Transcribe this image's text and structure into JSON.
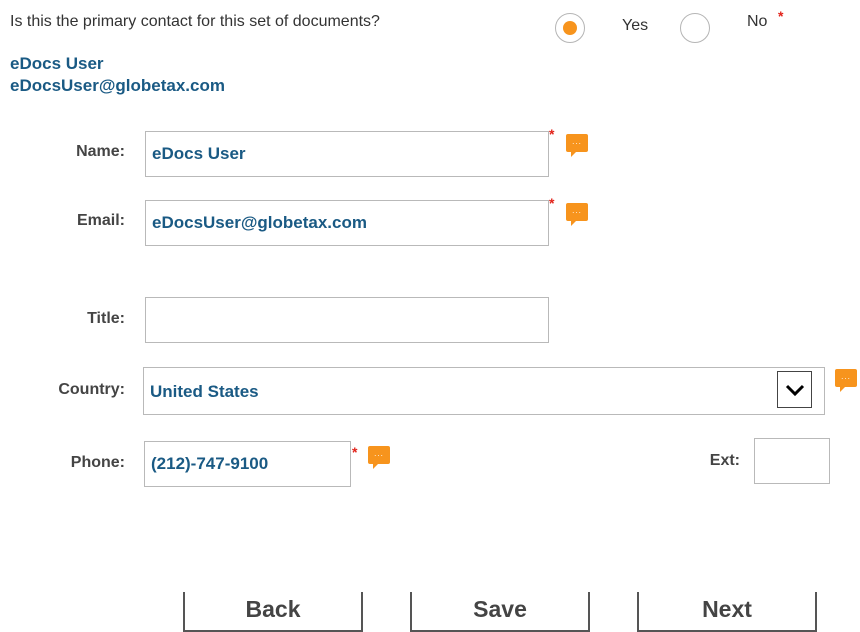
{
  "primary_contact": {
    "question": "Is this the primary contact for this set of documents?",
    "yes_label": "Yes",
    "no_label": "No",
    "selected": "Yes",
    "required_mark": "*"
  },
  "user": {
    "name": "eDocs User",
    "email": "eDocsUser@globetax.com"
  },
  "form": {
    "name_label": "Name:",
    "name_value": "eDocs User",
    "email_label": "Email:",
    "email_value": "eDocsUser@globetax.com",
    "title_label": "Title:",
    "title_value": "",
    "country_label": "Country:",
    "country_value": "United States",
    "phone_label": "Phone:",
    "phone_value": "(212)-747-9100",
    "ext_label": "Ext:",
    "ext_value": "",
    "required_mark": "*",
    "comment_icon_dots": "..."
  },
  "buttons": {
    "back": "Back",
    "save": "Save",
    "next": "Next"
  },
  "colors": {
    "accent_orange": "#f7941d",
    "link_blue": "#1a5a84",
    "required_red": "#e2231a"
  }
}
